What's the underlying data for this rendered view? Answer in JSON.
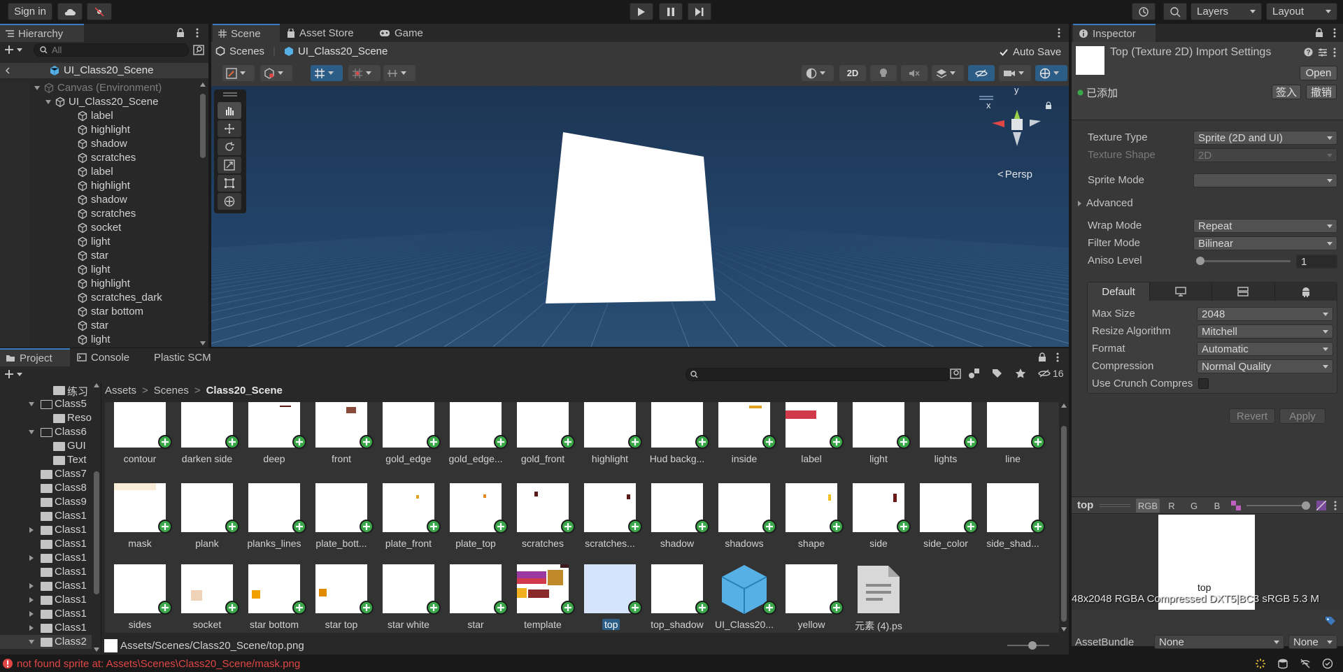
{
  "toolbar": {
    "sign_in": "Sign in",
    "layers": "Layers",
    "layout": "Layout"
  },
  "hierarchy": {
    "tab": "Hierarchy",
    "search_placeholder": "All",
    "scene": "UI_Class20_Scene",
    "items": [
      {
        "label": "Canvas (Environment)",
        "depth": 0,
        "expanded": true,
        "dim": true
      },
      {
        "label": "UI_Class20_Scene",
        "depth": 1,
        "expanded": true
      },
      {
        "label": "label",
        "depth": 2
      },
      {
        "label": "highlight",
        "depth": 2
      },
      {
        "label": "shadow",
        "depth": 2
      },
      {
        "label": "scratches",
        "depth": 2
      },
      {
        "label": "label",
        "depth": 2
      },
      {
        "label": "highlight",
        "depth": 2
      },
      {
        "label": "shadow",
        "depth": 2
      },
      {
        "label": "scratches",
        "depth": 2
      },
      {
        "label": "socket",
        "depth": 2
      },
      {
        "label": "light",
        "depth": 2
      },
      {
        "label": "star",
        "depth": 2
      },
      {
        "label": "light",
        "depth": 2
      },
      {
        "label": "highlight",
        "depth": 2
      },
      {
        "label": "scratches_dark",
        "depth": 2
      },
      {
        "label": "star bottom",
        "depth": 2
      },
      {
        "label": "star",
        "depth": 2
      },
      {
        "label": "light",
        "depth": 2
      }
    ]
  },
  "scene": {
    "tabs": [
      "Scene",
      "Asset Store",
      "Game"
    ],
    "breadcrumb_root": "Scenes",
    "breadcrumb_scene": "UI_Class20_Scene",
    "auto_save": "Auto Save",
    "mode_2d": "2D",
    "persp": "Persp",
    "gizmo_x": "x",
    "gizmo_y": "y"
  },
  "inspector": {
    "tab": "Inspector",
    "title": "Top (Texture 2D) Import Settings",
    "open": "Open",
    "added": "已添加",
    "checkin": "签入",
    "undo": "撤销",
    "fields": [
      {
        "label": "Texture Type",
        "value": "Sprite (2D and UI)",
        "disabled": false
      },
      {
        "label": "Texture Shape",
        "value": "2D",
        "disabled": true
      },
      {
        "label": "Sprite Mode",
        "value": "",
        "disabled": false
      }
    ],
    "advanced": "Advanced",
    "wrap_mode": {
      "label": "Wrap Mode",
      "value": "Repeat"
    },
    "filter_mode": {
      "label": "Filter Mode",
      "value": "Bilinear"
    },
    "aniso": {
      "label": "Aniso Level",
      "value": "1",
      "level": 0.0
    },
    "platform_tab": "Default",
    "platform_fields": [
      {
        "label": "Max Size",
        "value": "2048"
      },
      {
        "label": "Resize Algorithm",
        "value": "Mitchell"
      },
      {
        "label": "Format",
        "value": "Automatic"
      },
      {
        "label": "Compression",
        "value": "Normal Quality"
      }
    ],
    "crunch": "Use Crunch Compres",
    "revert": "Revert",
    "apply": "Apply",
    "preview": {
      "name": "top",
      "channels": [
        "RGB",
        "R",
        "G",
        "B"
      ],
      "image_label": "top",
      "info": "48x2048  RGBA Compressed DXT5|BC3 sRGB   5.3 M"
    },
    "asset_bundle": {
      "label": "AssetBundle",
      "value": "None",
      "variant": "None"
    }
  },
  "project": {
    "tabs": [
      "Project",
      "Console",
      "Plastic SCM"
    ],
    "hidden_count": "16",
    "breadcrumb": [
      "Assets",
      "Scenes",
      "Class20_Scene"
    ],
    "tree": [
      {
        "label": "练习",
        "indent": 2,
        "arrow": "",
        "open": false
      },
      {
        "label": "Class5",
        "indent": 1,
        "arrow": "down",
        "open": true
      },
      {
        "label": "Reso",
        "indent": 2,
        "arrow": "",
        "open": false
      },
      {
        "label": "Class6",
        "indent": 1,
        "arrow": "down",
        "open": true
      },
      {
        "label": "GUI",
        "indent": 2,
        "arrow": "",
        "open": false
      },
      {
        "label": "Text",
        "indent": 2,
        "arrow": "",
        "open": false
      },
      {
        "label": "Class7",
        "indent": 1,
        "arrow": "",
        "open": false
      },
      {
        "label": "Class8",
        "indent": 1,
        "arrow": "",
        "open": false
      },
      {
        "label": "Class9",
        "indent": 1,
        "arrow": "",
        "open": false
      },
      {
        "label": "Class1",
        "indent": 1,
        "arrow": "",
        "open": false
      },
      {
        "label": "Class1",
        "indent": 1,
        "arrow": "right",
        "open": false
      },
      {
        "label": "Class1",
        "indent": 1,
        "arrow": "",
        "open": false
      },
      {
        "label": "Class1",
        "indent": 1,
        "arrow": "right",
        "open": false
      },
      {
        "label": "Class1",
        "indent": 1,
        "arrow": "",
        "open": false
      },
      {
        "label": "Class1",
        "indent": 1,
        "arrow": "right",
        "open": false
      },
      {
        "label": "Class1",
        "indent": 1,
        "arrow": "right",
        "open": false
      },
      {
        "label": "Class1",
        "indent": 1,
        "arrow": "right",
        "open": false
      },
      {
        "label": "Class1",
        "indent": 1,
        "arrow": "right",
        "open": false
      },
      {
        "label": "Class2",
        "indent": 1,
        "arrow": "down",
        "open": false
      }
    ],
    "assets": [
      {
        "label": "contour"
      },
      {
        "label": "darken side"
      },
      {
        "label": "deep"
      },
      {
        "label": "front"
      },
      {
        "label": "gold_edge"
      },
      {
        "label": "gold_edge..."
      },
      {
        "label": "gold_front"
      },
      {
        "label": "highlight"
      },
      {
        "label": "Hud backg..."
      },
      {
        "label": "inside"
      },
      {
        "label": "label"
      },
      {
        "label": "light"
      },
      {
        "label": "lights"
      },
      {
        "label": "line"
      },
      {
        "label": "mask"
      },
      {
        "label": "plank"
      },
      {
        "label": "planks_lines"
      },
      {
        "label": "plate_bott..."
      },
      {
        "label": "plate_front"
      },
      {
        "label": "plate_top"
      },
      {
        "label": "scratches"
      },
      {
        "label": "scratches..."
      },
      {
        "label": "shadow"
      },
      {
        "label": "shadows"
      },
      {
        "label": "shape"
      },
      {
        "label": "side"
      },
      {
        "label": "side_color"
      },
      {
        "label": "side_shad..."
      },
      {
        "label": "sides"
      },
      {
        "label": "socket"
      },
      {
        "label": "star bottom"
      },
      {
        "label": "star top"
      },
      {
        "label": "star white"
      },
      {
        "label": "star"
      },
      {
        "label": "template"
      },
      {
        "label": "top"
      },
      {
        "label": "top_shadow"
      },
      {
        "label": "UI_Class20..."
      },
      {
        "label": "yellow"
      },
      {
        "label": "元素 (4).ps"
      }
    ],
    "selected_path": "Assets/Scenes/Class20_Scene/top.png"
  },
  "status": {
    "error": "not found sprite at: Assets\\Scenes\\Class20_Scene/mask.png"
  },
  "colors": {
    "accent": "#3a79bb",
    "selection": "#2c5d87",
    "error": "#e04646",
    "add_badge": "#3aa84a"
  }
}
